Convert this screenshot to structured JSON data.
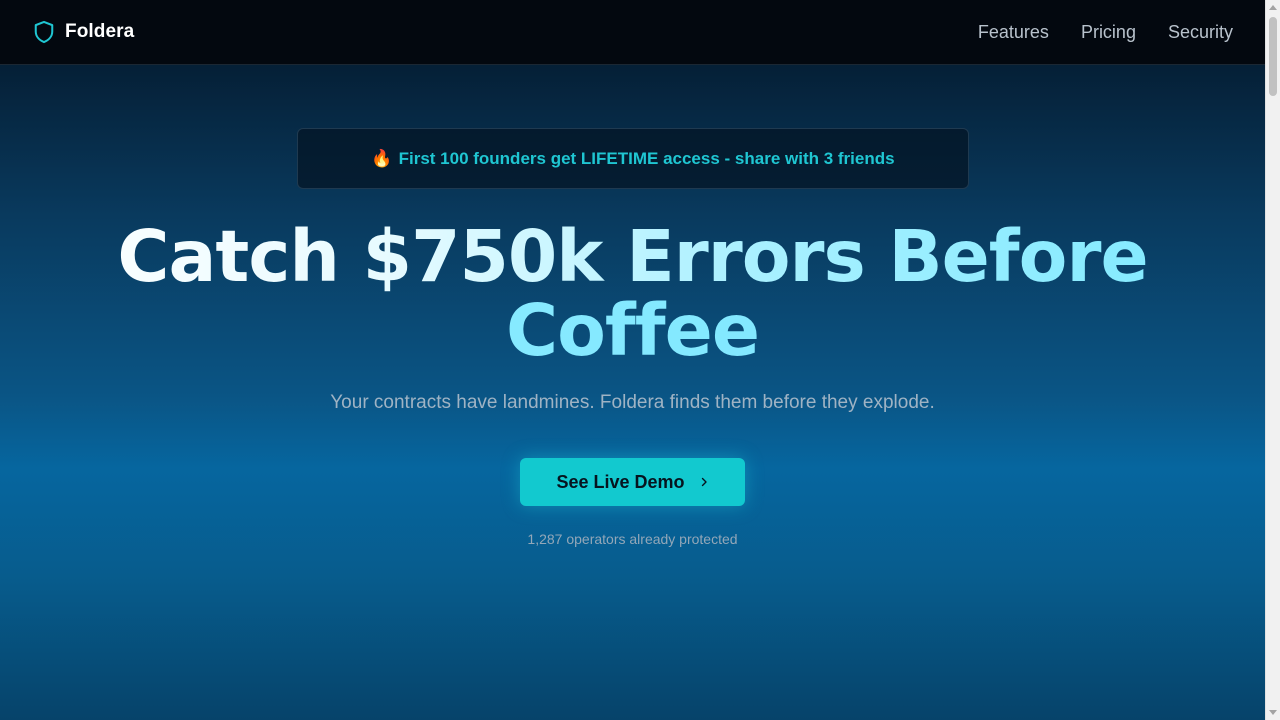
{
  "nav": {
    "brand": "Foldera",
    "links": [
      "Features",
      "Pricing",
      "Security"
    ]
  },
  "banner": {
    "emoji": "🔥",
    "text": "First 100 founders get LIFETIME access - share with 3 friends"
  },
  "hero": {
    "headline_part1": "Catch $750k Errors Before",
    "headline_part2": "Coffee",
    "subheadline": "Your contracts have landmines. Foldera finds them before they explode.",
    "cta_label": "See Live Demo",
    "social_proof": "1,287 operators already protected"
  },
  "colors": {
    "accent": "#12c9cf",
    "banner_text": "#1fc6d2",
    "nav_bg": "#03080f"
  },
  "icons": {
    "brand": "shield-icon",
    "cta": "chevron-right-icon"
  }
}
